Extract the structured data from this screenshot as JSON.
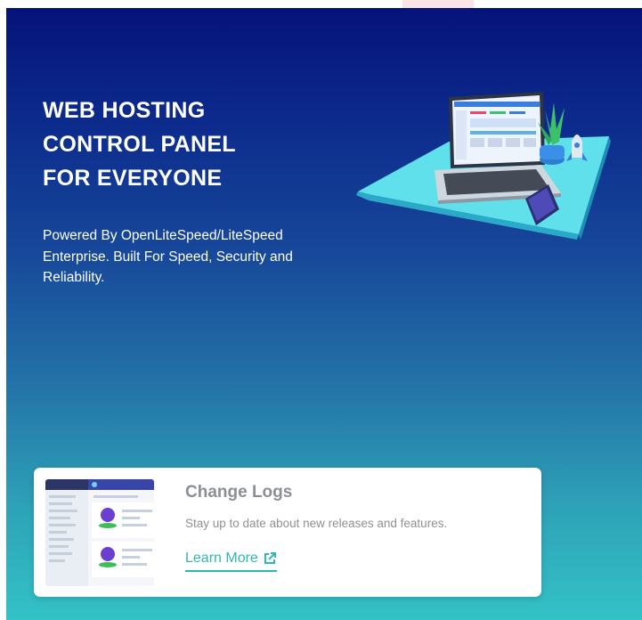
{
  "hero": {
    "title_lines": [
      "WEB HOSTING",
      "CONTROL PANEL",
      "FOR EVERYONE"
    ],
    "subtitle": "Powered By OpenLiteSpeed/LiteSpeed Enterprise. Built For Speed, Security and Reliability."
  },
  "card": {
    "title": "Change Logs",
    "description": "Stay up to date about new releases and features.",
    "link_label": "Learn More",
    "link_icon": "external-link-icon"
  },
  "colors": {
    "gradient_top": "#05127a",
    "gradient_bottom": "#33c2c6",
    "accent": "#2eb8b4"
  }
}
